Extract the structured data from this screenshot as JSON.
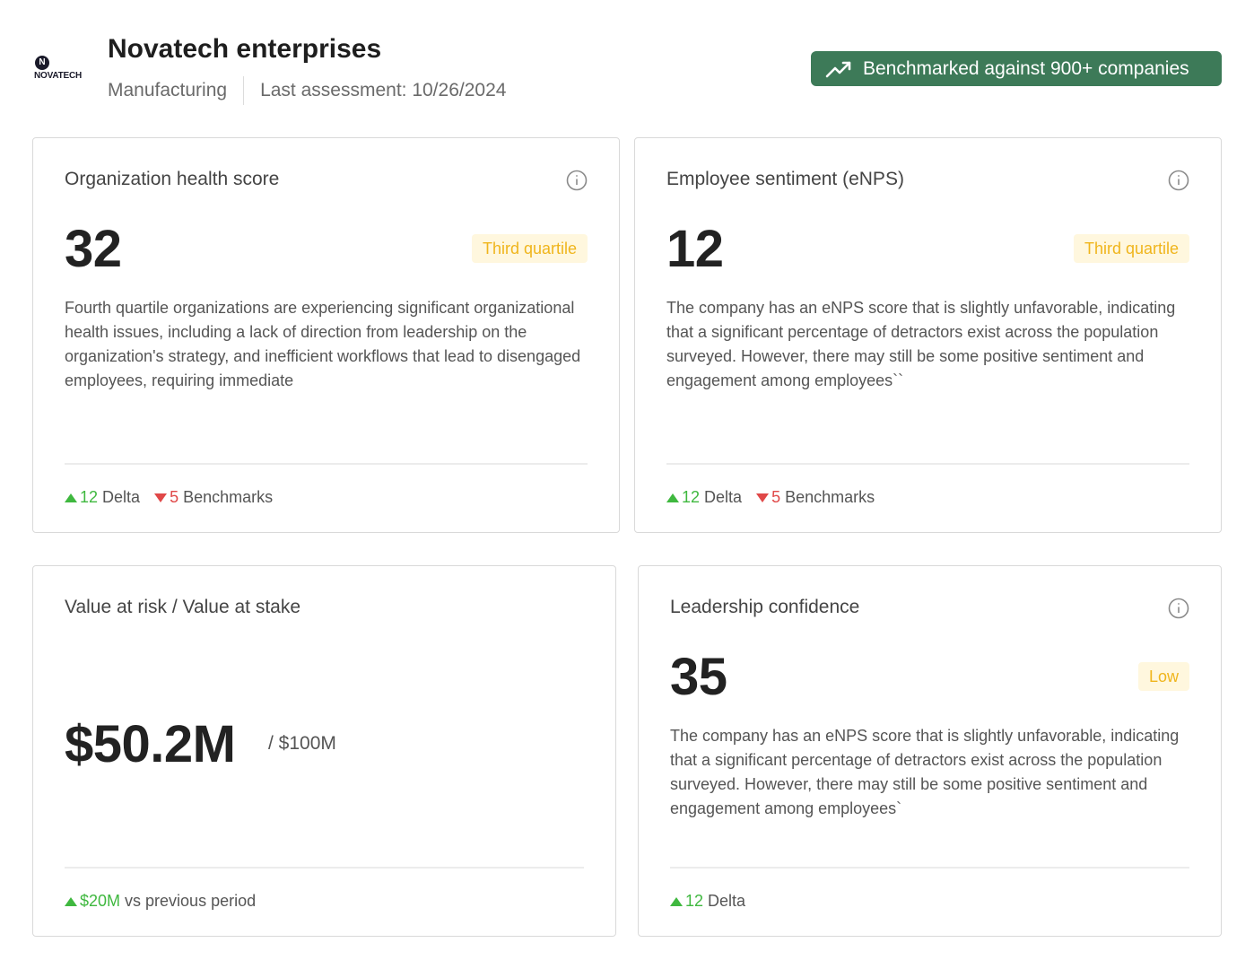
{
  "header": {
    "logo_letter": "N",
    "logo_text": "NOVATECH",
    "title": "Novatech enterprises",
    "industry": "Manufacturing",
    "last_assessment": "Last assessment: 10/26/2024",
    "benchmark_badge": "Benchmarked against 900+ companies"
  },
  "colors": {
    "badge_bg": "#3d7a58",
    "quartile_bg": "#fff7de",
    "quartile_text": "#f0b51c",
    "up": "#3fb83f",
    "down": "#e04848"
  },
  "cards": {
    "health": {
      "title": "Organization health score",
      "score": "32",
      "quartile": "Third quartile",
      "description": "Fourth quartile organizations are experiencing significant organizational health issues, including a lack of direction from leadership on the organization's strategy, and inefficient workflows that lead to disengaged employees, requiring immediate",
      "delta_value": "12",
      "delta_label": "Delta",
      "bench_value": "5",
      "bench_label": "Benchmarks"
    },
    "enps": {
      "title": "Employee sentiment (eNPS)",
      "score": "12",
      "quartile": "Third quartile",
      "description": "The company has an eNPS score that is slightly unfavorable, indicating that a significant percentage of detractors exist across the population surveyed. However, there may still be some positive sentiment and engagement among employees``",
      "delta_value": "12",
      "delta_label": "Delta",
      "bench_value": "5",
      "bench_label": "Benchmarks"
    },
    "value": {
      "title": "Value at risk / Value at stake",
      "amount": "$50.2M",
      "total": "/ $100M",
      "change_value": "$20M",
      "change_label": "vs previous period"
    },
    "leadership": {
      "title": "Leadership confidence",
      "score": "35",
      "level": "Low",
      "description": "The company has an eNPS score that is slightly unfavorable, indicating that a significant percentage of detractors exist across the population surveyed. However, there may still be some positive sentiment and engagement among employees`",
      "delta_value": "12",
      "delta_label": "Delta"
    }
  }
}
